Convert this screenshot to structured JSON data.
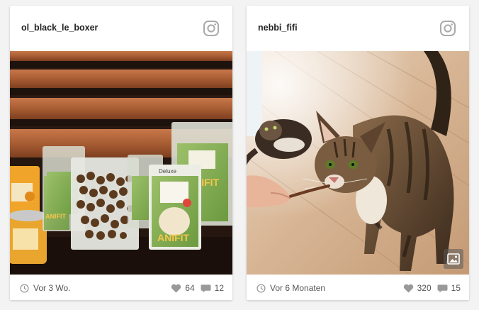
{
  "posts": [
    {
      "username": "ol_black_le_boxer",
      "time": "Vor 3 Wo.",
      "likes": "64",
      "comments": "12",
      "packages": [
        {
          "brand": "",
          "product": "ANIFIT"
        },
        {
          "brand": "Deluxe",
          "product": "ANIFIT"
        },
        {
          "brand": "",
          "product": "ANIFIT"
        }
      ],
      "icons": [
        "instagram-icon",
        "clock-icon",
        "heart-icon",
        "comment-icon"
      ]
    },
    {
      "username": "nebbi_fifi",
      "time": "Vor 6 Monaten",
      "likes": "320",
      "comments": "15",
      "icons": [
        "instagram-icon",
        "clock-icon",
        "heart-icon",
        "comment-icon",
        "gallery-icon"
      ]
    }
  ],
  "colors": {
    "background": "#f3f3f3",
    "card": "#ffffff",
    "icon_grey": "#aaaaaa",
    "wood": "#a45a2e"
  }
}
